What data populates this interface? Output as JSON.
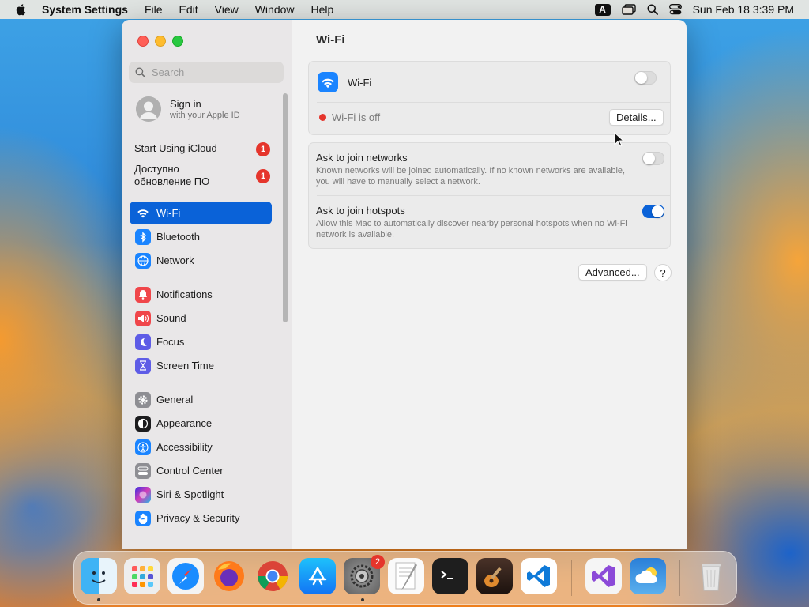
{
  "menubar": {
    "app_name": "System Settings",
    "items": [
      "File",
      "Edit",
      "View",
      "Window",
      "Help"
    ],
    "input_source": "A",
    "clock": "Sun Feb 18  3:39 PM"
  },
  "sidebar": {
    "search_placeholder": "Search",
    "account": {
      "title": "Sign in",
      "subtitle": "with your Apple ID"
    },
    "alerts": [
      {
        "label": "Start Using iCloud",
        "badge": "1"
      },
      {
        "label": "Доступно обновление ПО",
        "badge": "1"
      }
    ],
    "items": [
      {
        "label": "Wi-Fi",
        "icon": "wifi-icon",
        "color": "#1a84ff",
        "selected": true
      },
      {
        "label": "Bluetooth",
        "icon": "bluetooth-icon",
        "color": "#1a84ff"
      },
      {
        "label": "Network",
        "icon": "globe-icon",
        "color": "#1a84ff"
      },
      {
        "label": "Notifications",
        "icon": "bell-icon",
        "color": "#f0464a"
      },
      {
        "label": "Sound",
        "icon": "speaker-icon",
        "color": "#f0464a"
      },
      {
        "label": "Focus",
        "icon": "moon-icon",
        "color": "#5e5ce6"
      },
      {
        "label": "Screen Time",
        "icon": "hourglass-icon",
        "color": "#5e5ce6"
      },
      {
        "label": "General",
        "icon": "gear-icon",
        "color": "#8e8e93"
      },
      {
        "label": "Appearance",
        "icon": "appearance-icon",
        "color": "#1c1c1e"
      },
      {
        "label": "Accessibility",
        "icon": "accessibility-icon",
        "color": "#1a84ff"
      },
      {
        "label": "Control Center",
        "icon": "control-center-icon",
        "color": "#8e8e93"
      },
      {
        "label": "Siri & Spotlight",
        "icon": "siri-icon",
        "color": "#b045d8"
      },
      {
        "label": "Privacy & Security",
        "icon": "hand-icon",
        "color": "#1a84ff"
      }
    ]
  },
  "main": {
    "title": "Wi-Fi",
    "wifi_card": {
      "label": "Wi-Fi",
      "enabled": false,
      "status": "Wi-Fi is off",
      "status_color": "#e5352c",
      "details_button": "Details..."
    },
    "settings": [
      {
        "title": "Ask to join networks",
        "description": "Known networks will be joined automatically. If no known networks are available, you will have to manually select a network.",
        "enabled": false
      },
      {
        "title": "Ask to join hotspots",
        "description": "Allow this Mac to automatically discover nearby personal hotspots when no Wi-Fi network is available.",
        "enabled": true
      }
    ],
    "advanced_button": "Advanced...",
    "help_button": "?"
  },
  "dock": {
    "apps": [
      "Finder",
      "Launchpad",
      "Safari",
      "Firefox",
      "Chrome",
      "App Store",
      "System Settings",
      "TextEdit",
      "Terminal",
      "GarageBand",
      "Visual Studio Code",
      "Visual Studio",
      "Weather",
      "Trash"
    ],
    "system_settings_badge": "2"
  },
  "colors": {
    "accent": "#0a62d8",
    "badge": "#e5352c"
  }
}
